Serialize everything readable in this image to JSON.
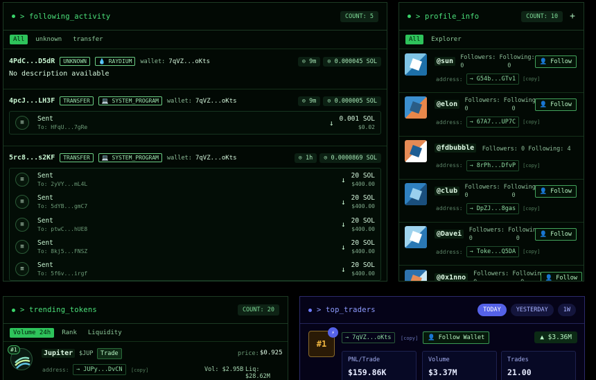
{
  "following": {
    "title": "> following_activity",
    "count": "COUNT: 5",
    "filters": [
      "All",
      "unknown",
      "transfer"
    ],
    "items": [
      {
        "sig": "4PdC...D5dR",
        "tags": [
          "UNKNOWN",
          "💧 RAYDIUM"
        ],
        "wallet_label": "wallet:",
        "wallet": "7qVZ...oKts",
        "time": "⊙ 9m",
        "fee": "⊙ 0.000045 SOL",
        "description": "No description available",
        "txs": []
      },
      {
        "sig": "4pcJ...LH3F",
        "tags": [
          "TRANSFER",
          "💻 SYSTEM_PROGRAM"
        ],
        "wallet_label": "wallet:",
        "wallet": "7qVZ...oKts",
        "time": "⊙ 9m",
        "fee": "⊙ 0.000005 SOL",
        "txs": [
          {
            "label": "Sent",
            "to": "To: HFqU...7gRe",
            "amount": "0.001 SOL",
            "usd": "$0.02"
          }
        ]
      },
      {
        "sig": "5rc8...s2KF",
        "tags": [
          "TRANSFER",
          "💻 SYSTEM_PROGRAM"
        ],
        "wallet_label": "wallet:",
        "wallet": "7qVZ...oKts",
        "time": "⊙ 1h",
        "fee": "⊙ 0.0000869 SOL",
        "txs": [
          {
            "label": "Sent",
            "to": "To: 2yVY...mL4L",
            "amount": "20 SOL",
            "usd": "$400.00"
          },
          {
            "label": "Sent",
            "to": "To: 5dYB...gmC7",
            "amount": "20 SOL",
            "usd": "$400.00"
          },
          {
            "label": "Sent",
            "to": "To: ptwC...hUE8",
            "amount": "20 SOL",
            "usd": "$400.00"
          },
          {
            "label": "Sent",
            "to": "To: 8kj5...FNSZ",
            "amount": "20 SOL",
            "usd": "$400.00"
          },
          {
            "label": "Sent",
            "to": "To: 5f6v...irgf",
            "amount": "20 SOL",
            "usd": "$400.00"
          }
        ]
      }
    ],
    "tx_icon": "≡",
    "arrow": "↓"
  },
  "profile": {
    "title": "> profile_info",
    "count": "COUNT: 10",
    "add": "+",
    "filters": [
      "All",
      "Explorer"
    ],
    "followers_label": "Followers:",
    "following_label": "Following:",
    "address_label": "address:",
    "copy": "[copy]",
    "follow": "Follow",
    "users": [
      {
        "name": "@sun",
        "followers": "0",
        "following": "0",
        "address": "→ G54b...GTv1",
        "colors": [
          "#7fc4e6",
          "#1d6fa8",
          "#ffffff"
        ]
      },
      {
        "name": "@elon",
        "followers": "0",
        "following": "0",
        "address": "→ 67A7...UP7C",
        "colors": [
          "#3c8fcf",
          "#e8874a",
          "#2a5d86"
        ]
      },
      {
        "name": "@fdbubble",
        "followers": "0",
        "following": "4",
        "address": "→ 8rPh...DfvP",
        "colors": [
          "#e68a55",
          "#ffffff",
          "#1f5e94"
        ]
      },
      {
        "name": "@club",
        "followers": "0",
        "following": "0",
        "address": "→ DpZJ...8gas",
        "colors": [
          "#2f80c0",
          "#1a4f7d",
          "#9ad0ee"
        ]
      },
      {
        "name": "@Davei",
        "followers": "0",
        "following": "0",
        "address": "→ Toke...Q5DA",
        "colors": [
          "#9fd3ee",
          "#2a78b5",
          "#ffffff"
        ]
      },
      {
        "name": "@0x1nno",
        "followers": "0",
        "following": "0",
        "address": "",
        "colors": [
          "#2e72ae",
          "#cfe8f6",
          "#e68a55"
        ]
      }
    ]
  },
  "trending": {
    "title": "> trending_tokens",
    "count": "COUNT: 20",
    "filters": [
      "Volume 24h",
      "Rank",
      "Liquidity"
    ],
    "token": {
      "rank": "#1",
      "name": "Jupiter",
      "symbol": "$JUP",
      "trade": "Trade",
      "price_label": "price:",
      "price": "$0.925",
      "address_label": "address:",
      "address": "→ JUPy...DvCN",
      "copy": "[copy]",
      "vol": "Vol: $2.95B",
      "liq": "Liq: $28.62M"
    }
  },
  "traders": {
    "title": "> top_traders",
    "ranges": [
      "TODAY",
      "YESTERDAY",
      "1W"
    ],
    "rank": "#1",
    "badge": "⚡",
    "wallet": "→ 7qVZ...oKts",
    "copy": "[copy]",
    "follow_wallet": "Follow Wallet",
    "pnl_total": "▲ $3.36M",
    "stats": [
      {
        "label": "PNL/Trade",
        "value": "$159.86K"
      },
      {
        "label": "Volume",
        "value": "$3.37M"
      },
      {
        "label": "Trades",
        "value": "21.00"
      }
    ]
  }
}
